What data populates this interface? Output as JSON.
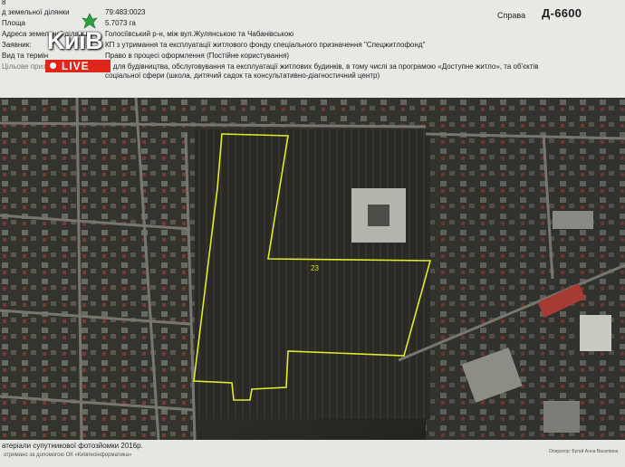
{
  "header": {
    "rows": [
      {
        "label": "д земельної ділянки",
        "value": "79:483:0023"
      },
      {
        "label": "Площа",
        "value": "5.7073 га"
      },
      {
        "label": "Адреса земельної ділянки",
        "value": "Голосіївський р-н, між вул.Жулянською та Чабанівською"
      },
      {
        "label": "Заявник:",
        "value": "КП з утримання та експлуатації житлового фонду спеціального призначення \"Спецжитлофонд\""
      },
      {
        "label": "Вид та термін",
        "value": "Право в процесі оформлення (Постійне користування)"
      },
      {
        "label": "Цільове призначення",
        "value": "0. для будівництва, обслуговування та експлуатації житлових будинків, в тому числі за програмою «Доступне житло», та об'єктів"
      },
      {
        "label": "",
        "value": "соціальної сфери (школа, дитячий садок та консультативно-діагностичний центр)"
      }
    ],
    "case_label": "Справа",
    "case_id": "Д-6600",
    "corner_mark": "8"
  },
  "logo": {
    "text": "KиїВ",
    "live_label": "LIVE",
    "live_color": "#e0251b"
  },
  "map": {
    "parcel_number": "23",
    "parcel_outline_color": "#e2ea2c"
  },
  "footer": {
    "source_text": "атеріали супутникової фотозйомки 2016р.",
    "source_subtext": "отримано за допомогою ОК «Київгеоінформатика»",
    "signature": "Оператор: Бугай Анна Василівна"
  }
}
